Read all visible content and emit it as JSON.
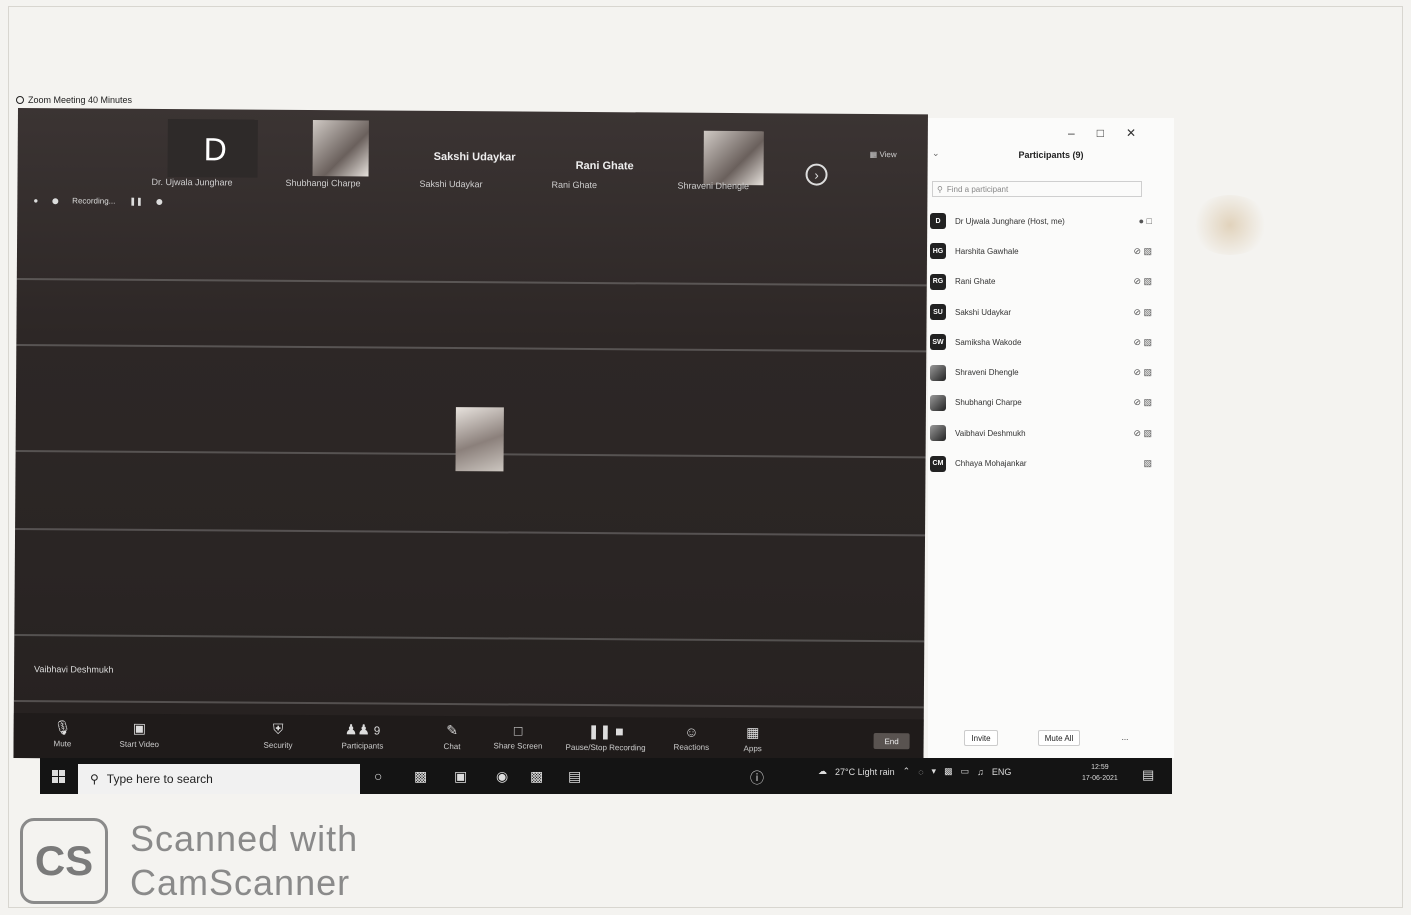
{
  "window": {
    "title": "Zoom Meeting 40 Minutes"
  },
  "strip": {
    "letter": "D",
    "names": [
      "Sakshi Udaykar",
      "Rani Ghate"
    ],
    "captions": [
      "Dr. Ujwala Junghare",
      "Shubhangi Charpe",
      "Sakshi Udaykar",
      "Rani Ghate",
      "Shraveni Dhengle"
    ],
    "view_label": "View",
    "recording_label": "Recording..."
  },
  "speaker": {
    "name": "Vaibhavi Deshmukh"
  },
  "controls": [
    {
      "label": "Mute",
      "icon": "microphone-icon"
    },
    {
      "label": "Start Video",
      "icon": "video-icon"
    },
    {
      "label": "Security",
      "icon": "shield-icon"
    },
    {
      "label": "Participants",
      "icon": "participants-icon",
      "count": "9"
    },
    {
      "label": "Chat",
      "icon": "chat-icon"
    },
    {
      "label": "Share Screen",
      "icon": "share-screen-icon"
    },
    {
      "label": "Pause/Stop Recording",
      "icon": "recording-icon"
    },
    {
      "label": "Reactions",
      "icon": "reactions-icon"
    },
    {
      "label": "Apps",
      "icon": "apps-icon"
    }
  ],
  "end_label": "End",
  "panel": {
    "title": "Participants (9)",
    "search_placeholder": "Find a participant",
    "invite_label": "Invite",
    "mute_all_label": "Mute All",
    "more_label": "...",
    "participants": [
      {
        "initials": "D",
        "name": "Dr Ujwala Junghare (Host, me)",
        "status": "mic-on video-off"
      },
      {
        "initials": "HG",
        "name": "Harshita Gawhale",
        "status": "muted video-off"
      },
      {
        "initials": "RG",
        "name": "Rani Ghate",
        "status": "muted video-off"
      },
      {
        "initials": "SU",
        "name": "Sakshi Udaykar",
        "status": "muted video-off"
      },
      {
        "initials": "SW",
        "name": "Samiksha Wakode",
        "status": "muted video-off"
      },
      {
        "initials": "",
        "name": "Shraveni Dhengle",
        "status": "muted video-off"
      },
      {
        "initials": "",
        "name": "Shubhangi Charpe",
        "status": "muted video-off"
      },
      {
        "initials": "",
        "name": "Vaibhavi Deshmukh",
        "status": "muted video-off"
      },
      {
        "initials": "CM",
        "name": "Chhaya Mohajankar",
        "status": "video-off"
      }
    ]
  },
  "taskbar": {
    "search_placeholder": "Type here to search",
    "weather": "27°C Light rain",
    "language": "ENG",
    "time": "12:59",
    "date": "17-06-2021"
  },
  "watermark": {
    "logo": "CS",
    "line1": "Scanned with",
    "line2": "CamScanner"
  }
}
